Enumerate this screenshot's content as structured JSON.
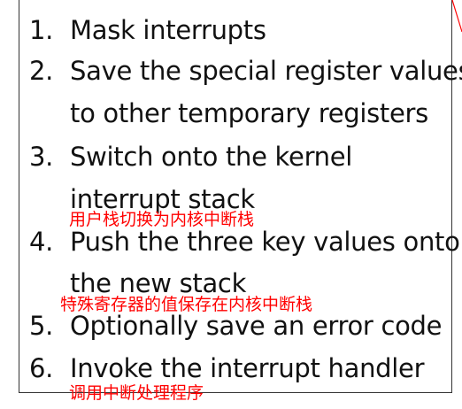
{
  "steps": [
    {
      "num": "1.",
      "lines": [
        "Mask interrupts"
      ]
    },
    {
      "num": "2.",
      "lines": [
        "Save the special register values",
        "to other temporary registers"
      ]
    },
    {
      "num": "3.",
      "lines": [
        "Switch onto the kernel",
        "interrupt stack"
      ]
    },
    {
      "num": "4.",
      "lines": [
        "Push the three key values onto",
        "the new stack"
      ]
    },
    {
      "num": "5.",
      "lines": [
        "Optionally save an error code"
      ]
    },
    {
      "num": "6.",
      "lines": [
        "Invoke the interrupt handler"
      ]
    }
  ],
  "annotations": [
    "用户栈切换为内核中断栈",
    "特殊寄存器的值保存在内核中断栈",
    "调用中断处理程序"
  ],
  "colors": {
    "annotation": "#ff0000",
    "text": "#111111",
    "border": "#333333"
  }
}
